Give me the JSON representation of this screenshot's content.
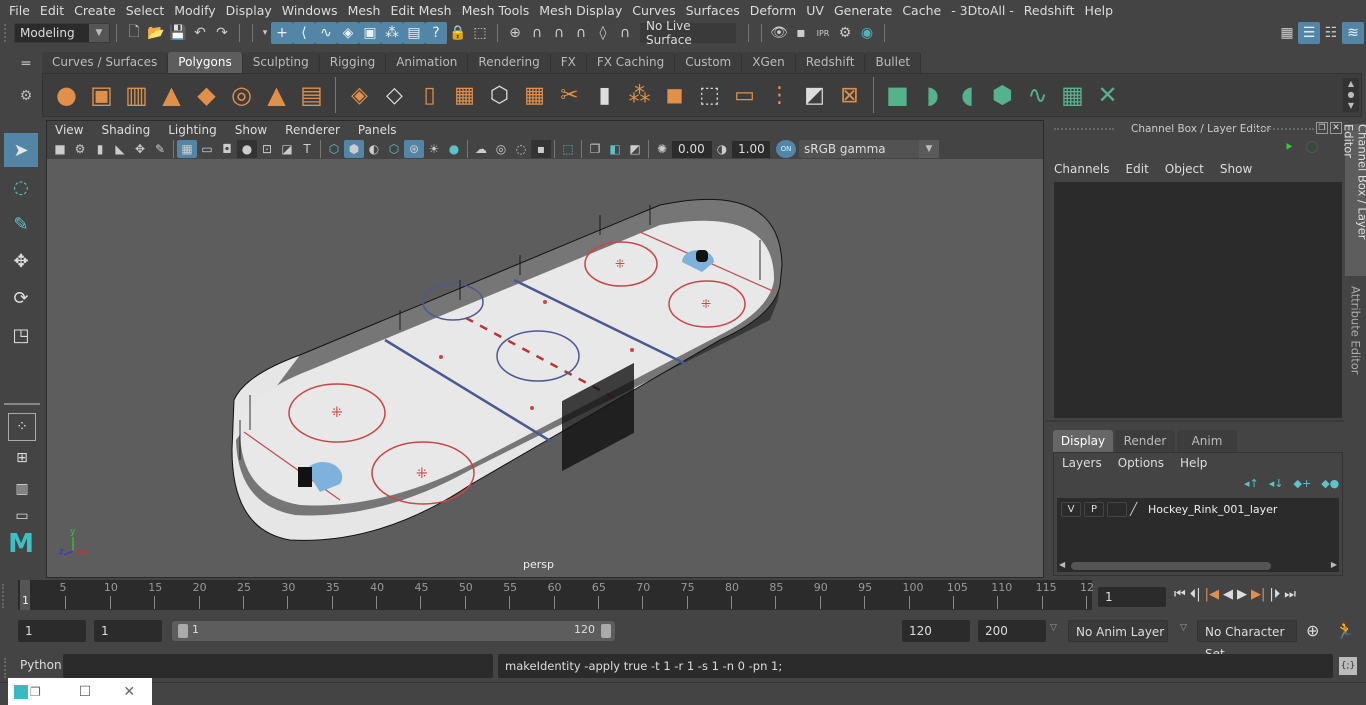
{
  "menubar": [
    "File",
    "Edit",
    "Create",
    "Select",
    "Modify",
    "Display",
    "Windows",
    "Mesh",
    "Edit Mesh",
    "Mesh Tools",
    "Mesh Display",
    "Curves",
    "Surfaces",
    "Deform",
    "UV",
    "Generate",
    "Cache",
    "- 3DtoAll -",
    "Redshift",
    "Help"
  ],
  "status_line": {
    "mode": "Modeling",
    "live_surface": "No Live Surface"
  },
  "shelf": {
    "tabs": [
      "Curves / Surfaces",
      "Polygons",
      "Sculpting",
      "Rigging",
      "Animation",
      "Rendering",
      "FX",
      "FX Caching",
      "Custom",
      "XGen",
      "Redshift",
      "Bullet"
    ],
    "active_tab": "Polygons",
    "orange_icons": [
      "sphere",
      "cube",
      "cylinder",
      "cone",
      "plane",
      "torus",
      "pyramid",
      "pipe"
    ],
    "tool_icons": [
      "combine",
      "separate",
      "mirror",
      "smooth",
      "bevel-cube",
      "extract",
      "multi-cut",
      "extrude",
      "bridge",
      "fill-hole",
      "append",
      "edge-loop",
      "insert-edge",
      "merge",
      "collapse"
    ],
    "uv_icons": [
      "planar-uv",
      "cylindrical-uv",
      "spherical-uv",
      "auto-uv",
      "unfold-uv",
      "uv-editor",
      "uv-sew"
    ]
  },
  "viewport": {
    "menu": [
      "View",
      "Shading",
      "Lighting",
      "Show",
      "Renderer",
      "Panels"
    ],
    "exposure": "0.00",
    "gamma": "1.00",
    "color_space": "sRGB gamma",
    "camera_label": "persp",
    "axes": {
      "x": "x",
      "y": "y",
      "z": "z"
    }
  },
  "channel_box": {
    "title": "Channel Box / Layer Editor",
    "menu": [
      "Channels",
      "Edit",
      "Object",
      "Show"
    ]
  },
  "layer_editor": {
    "tabs": [
      "Display",
      "Render",
      "Anim"
    ],
    "active_tab": "Display",
    "menu": [
      "Layers",
      "Options",
      "Help"
    ],
    "layers": [
      {
        "v": "V",
        "p": "P",
        "name": "Hockey_Rink_001_layer"
      }
    ]
  },
  "side_tabs": [
    "Channel Box / Layer Editor",
    "Attribute Editor"
  ],
  "timeline": {
    "ticks": [
      "5",
      "10",
      "15",
      "20",
      "25",
      "30",
      "35",
      "40",
      "45",
      "50",
      "55",
      "60",
      "65",
      "70",
      "75",
      "80",
      "85",
      "90",
      "95",
      "100",
      "105",
      "110",
      "115",
      "12"
    ],
    "current_marker": "1",
    "current_frame": "1"
  },
  "range": {
    "start": "1",
    "anim_start": "1",
    "slider_start": "1",
    "slider_end": "120",
    "end": "120",
    "anim_end": "200",
    "anim_layer": "No Anim Layer",
    "character_set": "No Character Set"
  },
  "command_line": {
    "language": "Python",
    "input": "",
    "result": "makeIdentity -apply true -t 1 -r 1 -s 1 -n 0 -pn 1;"
  },
  "colors": {
    "accent_blue": "#5285a6",
    "shelf_orange": "#e0904a",
    "shelf_green": "#56b28c",
    "teal": "#4fb6c0"
  }
}
